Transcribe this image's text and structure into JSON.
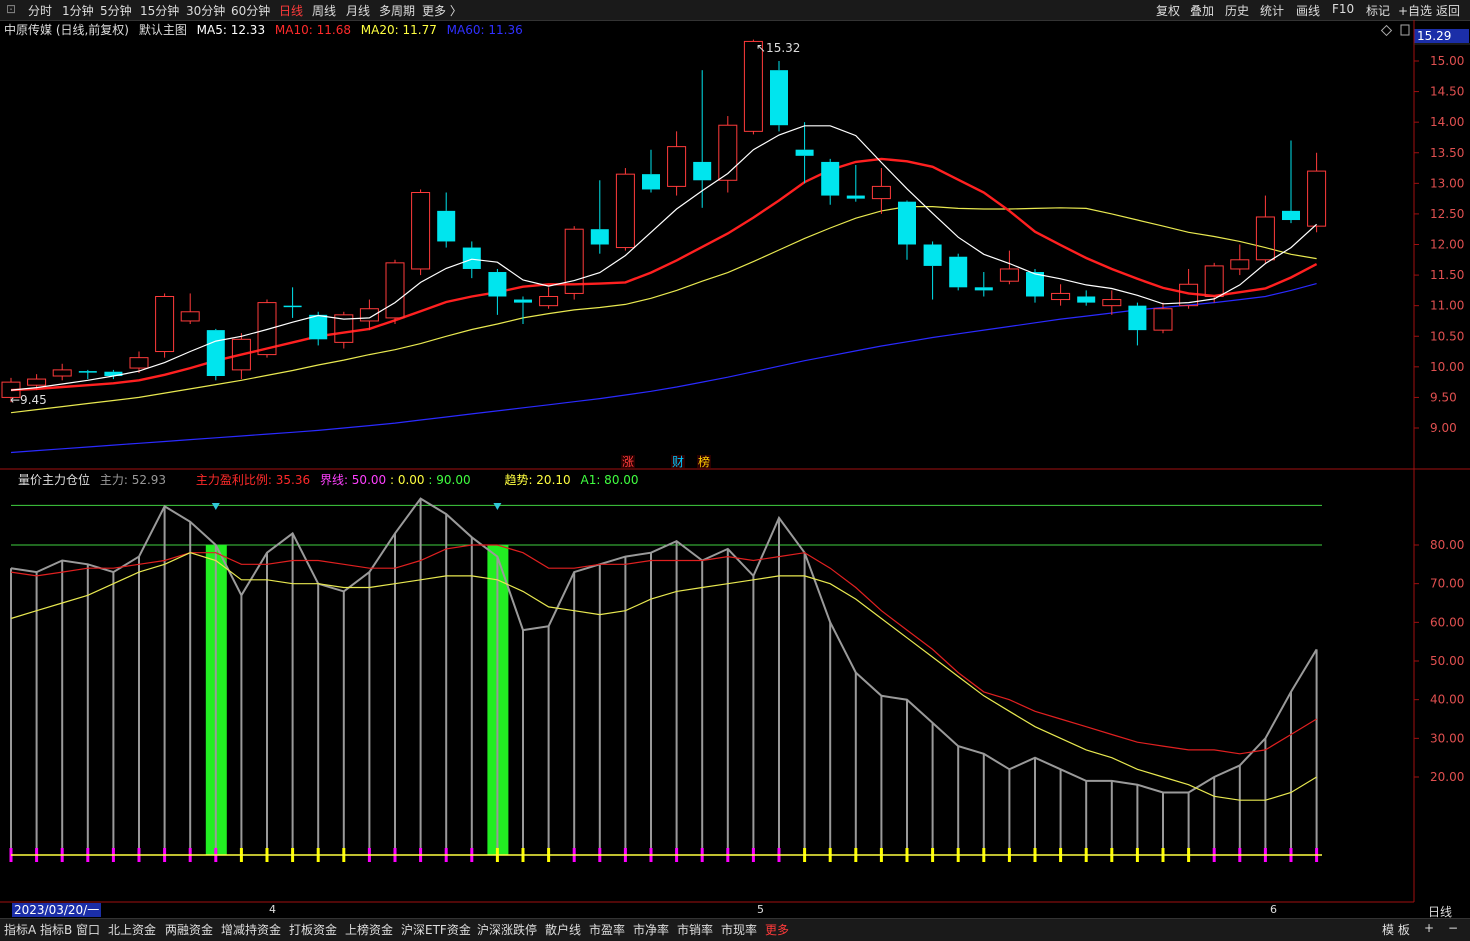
{
  "toolbar": {
    "left": [
      "分时",
      "1分钟",
      "5分钟",
      "15分钟",
      "30分钟",
      "60分钟",
      "日线",
      "周线",
      "月线",
      "多周期",
      "更多 〉"
    ],
    "active": "日线",
    "right": [
      "复权",
      "叠加",
      "历史",
      "统计",
      "画线",
      "F10",
      "标记",
      "+自选",
      "返回"
    ]
  },
  "main_info": {
    "title": "中原传媒 (日线,前复权)",
    "chart_name": "默认主图",
    "ma5": "MA5: 12.33",
    "ma10": "MA10: 11.68",
    "ma20": "MA20: 11.77",
    "ma60": "MA60: 11.36",
    "colors": {
      "ma5": "#ffffff",
      "ma10": "#ff2a2a",
      "ma20": "#ffff40",
      "ma60": "#3030ff",
      "up": "#ff3b3b",
      "down": "#00e5ee"
    }
  },
  "price_box": "15.29",
  "high_label": "15.32",
  "low_label": "9.45",
  "event_markers": [
    "涨",
    "财",
    "榜"
  ],
  "y_axis_main": [
    "15.00",
    "14.50",
    "14.00",
    "13.50",
    "13.00",
    "12.50",
    "12.00",
    "11.50",
    "11.00",
    "10.50",
    "10.00",
    "9.50",
    "9.00"
  ],
  "indicator_info": {
    "name": "量价主力仓位",
    "zhuli": "主力: 52.93",
    "ratio": "主力盈利比例: 35.36",
    "jiexian": "界线: 50.00",
    "v1": ": 0.00",
    "v2": ": 90.00",
    "trend": "趋势: 20.10",
    "a1": "A1: 80.00"
  },
  "y_axis_ind": [
    "80.00",
    "70.00",
    "60.00",
    "50.00",
    "40.00",
    "30.00",
    "20.00"
  ],
  "x_axis": {
    "date": "2023/03/20/一",
    "ticks": [
      "4",
      "5",
      "6"
    ],
    "period": "日线"
  },
  "bottom_tabs": [
    "指标A",
    "指标B",
    "窗口",
    "北上资金",
    "两融资金",
    "增减持资金",
    "打板资金",
    "上榜资金",
    "沪深ETF资金",
    "沪深涨跌停",
    "散户线",
    "市盈率",
    "市净率",
    "市销率",
    "市现率",
    "更多"
  ],
  "bottom_active": "更多",
  "chart_data": [
    {
      "type": "candlestick",
      "ylim": [
        8.7,
        15.6
      ],
      "candles": [
        {
          "o": 9.5,
          "c": 9.75,
          "h": 9.82,
          "l": 9.42
        },
        {
          "o": 9.7,
          "c": 9.8,
          "h": 9.88,
          "l": 9.62
        },
        {
          "o": 9.85,
          "c": 9.95,
          "h": 10.05,
          "l": 9.78
        },
        {
          "o": 9.93,
          "c": 9.92,
          "h": 9.95,
          "l": 9.8
        },
        {
          "o": 9.92,
          "c": 9.85,
          "h": 9.95,
          "l": 9.8
        },
        {
          "o": 9.98,
          "c": 10.15,
          "h": 10.25,
          "l": 9.9
        },
        {
          "o": 10.25,
          "c": 11.15,
          "h": 11.2,
          "l": 10.15
        },
        {
          "o": 10.75,
          "c": 10.9,
          "h": 11.2,
          "l": 10.7
        },
        {
          "o": 10.6,
          "c": 9.85,
          "h": 10.62,
          "l": 9.78
        },
        {
          "o": 9.95,
          "c": 10.45,
          "h": 10.55,
          "l": 9.8
        },
        {
          "o": 10.2,
          "c": 11.05,
          "h": 11.1,
          "l": 10.15
        },
        {
          "o": 11.0,
          "c": 10.98,
          "h": 11.3,
          "l": 10.8
        },
        {
          "o": 10.85,
          "c": 10.45,
          "h": 10.9,
          "l": 10.35
        },
        {
          "o": 10.4,
          "c": 10.85,
          "h": 10.9,
          "l": 10.3
        },
        {
          "o": 10.75,
          "c": 10.95,
          "h": 11.1,
          "l": 10.6
        },
        {
          "o": 10.8,
          "c": 11.7,
          "h": 11.75,
          "l": 10.7
        },
        {
          "o": 11.6,
          "c": 12.85,
          "h": 12.9,
          "l": 11.5
        },
        {
          "o": 12.55,
          "c": 12.05,
          "h": 12.85,
          "l": 11.95
        },
        {
          "o": 11.95,
          "c": 11.6,
          "h": 12.05,
          "l": 11.45
        },
        {
          "o": 11.55,
          "c": 11.15,
          "h": 11.6,
          "l": 10.85
        },
        {
          "o": 11.1,
          "c": 11.05,
          "h": 11.15,
          "l": 10.7
        },
        {
          "o": 11.0,
          "c": 11.15,
          "h": 11.3,
          "l": 10.95
        },
        {
          "o": 11.2,
          "c": 12.25,
          "h": 12.3,
          "l": 11.1
        },
        {
          "o": 12.25,
          "c": 12.0,
          "h": 13.05,
          "l": 11.85
        },
        {
          "o": 11.95,
          "c": 13.15,
          "h": 13.25,
          "l": 11.9
        },
        {
          "o": 13.15,
          "c": 12.9,
          "h": 13.55,
          "l": 12.85
        },
        {
          "o": 12.95,
          "c": 13.6,
          "h": 13.85,
          "l": 12.8
        },
        {
          "o": 13.35,
          "c": 13.05,
          "h": 14.85,
          "l": 12.6
        },
        {
          "o": 13.05,
          "c": 13.95,
          "h": 14.1,
          "l": 12.85
        },
        {
          "o": 13.85,
          "c": 15.32,
          "h": 15.35,
          "l": 13.8
        },
        {
          "o": 14.85,
          "c": 13.95,
          "h": 15.0,
          "l": 13.85
        },
        {
          "o": 13.55,
          "c": 13.45,
          "h": 14.0,
          "l": 13.0
        },
        {
          "o": 13.35,
          "c": 12.8,
          "h": 13.4,
          "l": 12.65
        },
        {
          "o": 12.8,
          "c": 12.75,
          "h": 13.3,
          "l": 12.7
        },
        {
          "o": 12.75,
          "c": 12.95,
          "h": 13.25,
          "l": 12.5
        },
        {
          "o": 12.7,
          "c": 12.0,
          "h": 12.72,
          "l": 11.75
        },
        {
          "o": 12.0,
          "c": 11.65,
          "h": 12.05,
          "l": 11.1
        },
        {
          "o": 11.8,
          "c": 11.3,
          "h": 11.85,
          "l": 11.25
        },
        {
          "o": 11.3,
          "c": 11.25,
          "h": 11.55,
          "l": 11.15
        },
        {
          "o": 11.4,
          "c": 11.6,
          "h": 11.9,
          "l": 11.35
        },
        {
          "o": 11.55,
          "c": 11.15,
          "h": 11.6,
          "l": 11.05
        },
        {
          "o": 11.1,
          "c": 11.2,
          "h": 11.35,
          "l": 11.0
        },
        {
          "o": 11.15,
          "c": 11.05,
          "h": 11.25,
          "l": 11.0
        },
        {
          "o": 11.0,
          "c": 11.1,
          "h": 11.25,
          "l": 10.85
        },
        {
          "o": 11.0,
          "c": 10.6,
          "h": 11.05,
          "l": 10.35
        },
        {
          "o": 10.6,
          "c": 10.95,
          "h": 11.05,
          "l": 10.55
        },
        {
          "o": 11.0,
          "c": 11.35,
          "h": 11.6,
          "l": 10.95
        },
        {
          "o": 11.15,
          "c": 11.65,
          "h": 11.7,
          "l": 11.05
        },
        {
          "o": 11.6,
          "c": 11.75,
          "h": 12.0,
          "l": 11.5
        },
        {
          "o": 11.75,
          "c": 12.45,
          "h": 12.8,
          "l": 11.7
        },
        {
          "o": 12.55,
          "c": 12.4,
          "h": 13.7,
          "l": 12.35
        },
        {
          "o": 12.3,
          "c": 13.2,
          "h": 13.5,
          "l": 12.2
        }
      ],
      "ma5": [
        9.62,
        9.66,
        9.72,
        9.78,
        9.85,
        9.93,
        10.07,
        10.25,
        10.42,
        10.5,
        10.61,
        10.73,
        10.84,
        10.78,
        10.8,
        11.05,
        11.38,
        11.61,
        11.76,
        11.71,
        11.42,
        11.32,
        11.41,
        11.54,
        11.82,
        12.2,
        12.58,
        12.88,
        13.16,
        13.55,
        13.79,
        13.94,
        13.94,
        13.78,
        13.34,
        12.91,
        12.51,
        12.12,
        11.84,
        11.69,
        11.52,
        11.44,
        11.34,
        11.28,
        11.17,
        11.03,
        11.05,
        11.11,
        11.34,
        11.69,
        11.95,
        12.33
      ],
      "ma10": [
        9.62,
        9.64,
        9.67,
        9.7,
        9.73,
        9.78,
        9.87,
        9.98,
        10.1,
        10.2,
        10.3,
        10.4,
        10.5,
        10.56,
        10.62,
        10.76,
        10.91,
        11.06,
        11.15,
        11.22,
        11.31,
        11.35,
        11.35,
        11.36,
        11.38,
        11.54,
        11.74,
        11.96,
        12.18,
        12.44,
        12.72,
        13.02,
        13.22,
        13.35,
        13.4,
        13.36,
        13.27,
        13.06,
        12.85,
        12.55,
        12.21,
        11.99,
        11.78,
        11.6,
        11.44,
        11.29,
        11.2,
        11.16,
        11.22,
        11.28,
        11.46,
        11.68
      ],
      "ma20": [
        9.25,
        9.3,
        9.35,
        9.4,
        9.45,
        9.5,
        9.57,
        9.64,
        9.71,
        9.78,
        9.86,
        9.94,
        10.03,
        10.11,
        10.2,
        10.28,
        10.38,
        10.5,
        10.61,
        10.7,
        10.8,
        10.87,
        10.93,
        10.97,
        11.02,
        11.12,
        11.25,
        11.4,
        11.54,
        11.72,
        11.91,
        12.1,
        12.27,
        12.43,
        12.55,
        12.62,
        12.62,
        12.59,
        12.58,
        12.58,
        12.59,
        12.6,
        12.59,
        12.5,
        12.4,
        12.3,
        12.2,
        12.13,
        12.05,
        11.95,
        11.84,
        11.77
      ],
      "ma60": [
        8.6,
        8.63,
        8.66,
        8.69,
        8.72,
        8.75,
        8.78,
        8.81,
        8.84,
        8.87,
        8.9,
        8.93,
        8.96,
        9.0,
        9.04,
        9.08,
        9.13,
        9.18,
        9.23,
        9.28,
        9.33,
        9.38,
        9.43,
        9.48,
        9.54,
        9.6,
        9.67,
        9.75,
        9.83,
        9.92,
        10.01,
        10.1,
        10.18,
        10.26,
        10.34,
        10.41,
        10.48,
        10.54,
        10.6,
        10.66,
        10.72,
        10.78,
        10.83,
        10.88,
        10.93,
        10.97,
        11.01,
        11.05,
        11.1,
        11.15,
        11.25,
        11.36
      ]
    },
    {
      "type": "bar",
      "ylim": [
        0,
        100
      ],
      "main_force": [
        74,
        73,
        76,
        75,
        73,
        77,
        90,
        86,
        80,
        67,
        78,
        83,
        70,
        68,
        73,
        83,
        92,
        88,
        82,
        77,
        58,
        59,
        73,
        75,
        77,
        78,
        81,
        76,
        79,
        72,
        87,
        78,
        60,
        47,
        41,
        40,
        34,
        28,
        26,
        22,
        25,
        22,
        19,
        19,
        18,
        16,
        16,
        20,
        23,
        30,
        42,
        53
      ],
      "profit_ratio": [
        73,
        72,
        73,
        74,
        74,
        75,
        76,
        78,
        78,
        75,
        75,
        76,
        76,
        75,
        74,
        74,
        76,
        79,
        80,
        80,
        78,
        74,
        74,
        75,
        75,
        76,
        76,
        76,
        77,
        76,
        77,
        78,
        74,
        69,
        63,
        58,
        53,
        47,
        42,
        40,
        37,
        35,
        33,
        31,
        29,
        28,
        27,
        27,
        26,
        27,
        31,
        35
      ],
      "trend": [
        61,
        63,
        65,
        67,
        70,
        73,
        75,
        78,
        76,
        71,
        71,
        70,
        70,
        69,
        69,
        70,
        71,
        72,
        72,
        71,
        68,
        64,
        63,
        62,
        63,
        66,
        68,
        69,
        70,
        71,
        72,
        72,
        70,
        66,
        61,
        56,
        51,
        46,
        41,
        37,
        33,
        30,
        27,
        25,
        22,
        20,
        18,
        15,
        14,
        14,
        16,
        20
      ],
      "green_bars": [
        8,
        19
      ],
      "bottom_ticks_color": [
        "#ff00ff",
        "#ff00ff",
        "#ff00ff",
        "#ff00ff",
        "#ff00ff",
        "#ff00ff",
        "#ff00ff",
        "#ff00ff",
        "#ff00ff",
        "#ffff00",
        "#ffff00",
        "#ffff00",
        "#ffff00",
        "#ffff00",
        "#ff00ff",
        "#ff00ff",
        "#ff00ff",
        "#ff00ff",
        "#ff00ff",
        "#ffff00",
        "#ffff00",
        "#ffff00",
        "#ff00ff",
        "#ff00ff",
        "#ff00ff",
        "#ff00ff",
        "#ff00ff",
        "#ff00ff",
        "#ff00ff",
        "#ff00ff",
        "#ff00ff",
        "#ffff00",
        "#ffff00",
        "#ffff00",
        "#ffff00",
        "#ffff00",
        "#ffff00",
        "#ffff00",
        "#ffff00",
        "#ffff00",
        "#ffff00",
        "#ffff00",
        "#ffff00",
        "#ffff00",
        "#ffff00",
        "#ffff00",
        "#ffff00",
        "#ff00ff",
        "#ff00ff",
        "#ff00ff",
        "#ff00ff",
        "#ff00ff"
      ],
      "lines": {
        "line_90": 90,
        "line_80": 80
      }
    }
  ]
}
